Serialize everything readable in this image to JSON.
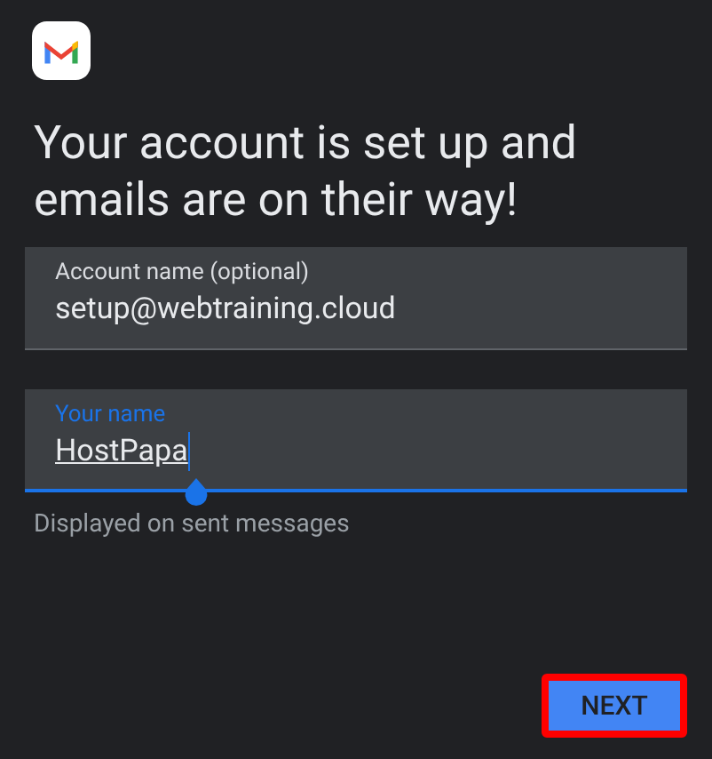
{
  "heading": "Your account is set up and emails are on their way!",
  "fields": [
    {
      "label": "Account name (optional)",
      "value": "setup@webtraining.cloud",
      "focused": false
    },
    {
      "label": "Your name",
      "value": "HostPapa",
      "focused": true,
      "helper": "Displayed on sent messages"
    }
  ],
  "buttons": [
    {
      "label": "NEXT",
      "highlighted": true
    }
  ]
}
